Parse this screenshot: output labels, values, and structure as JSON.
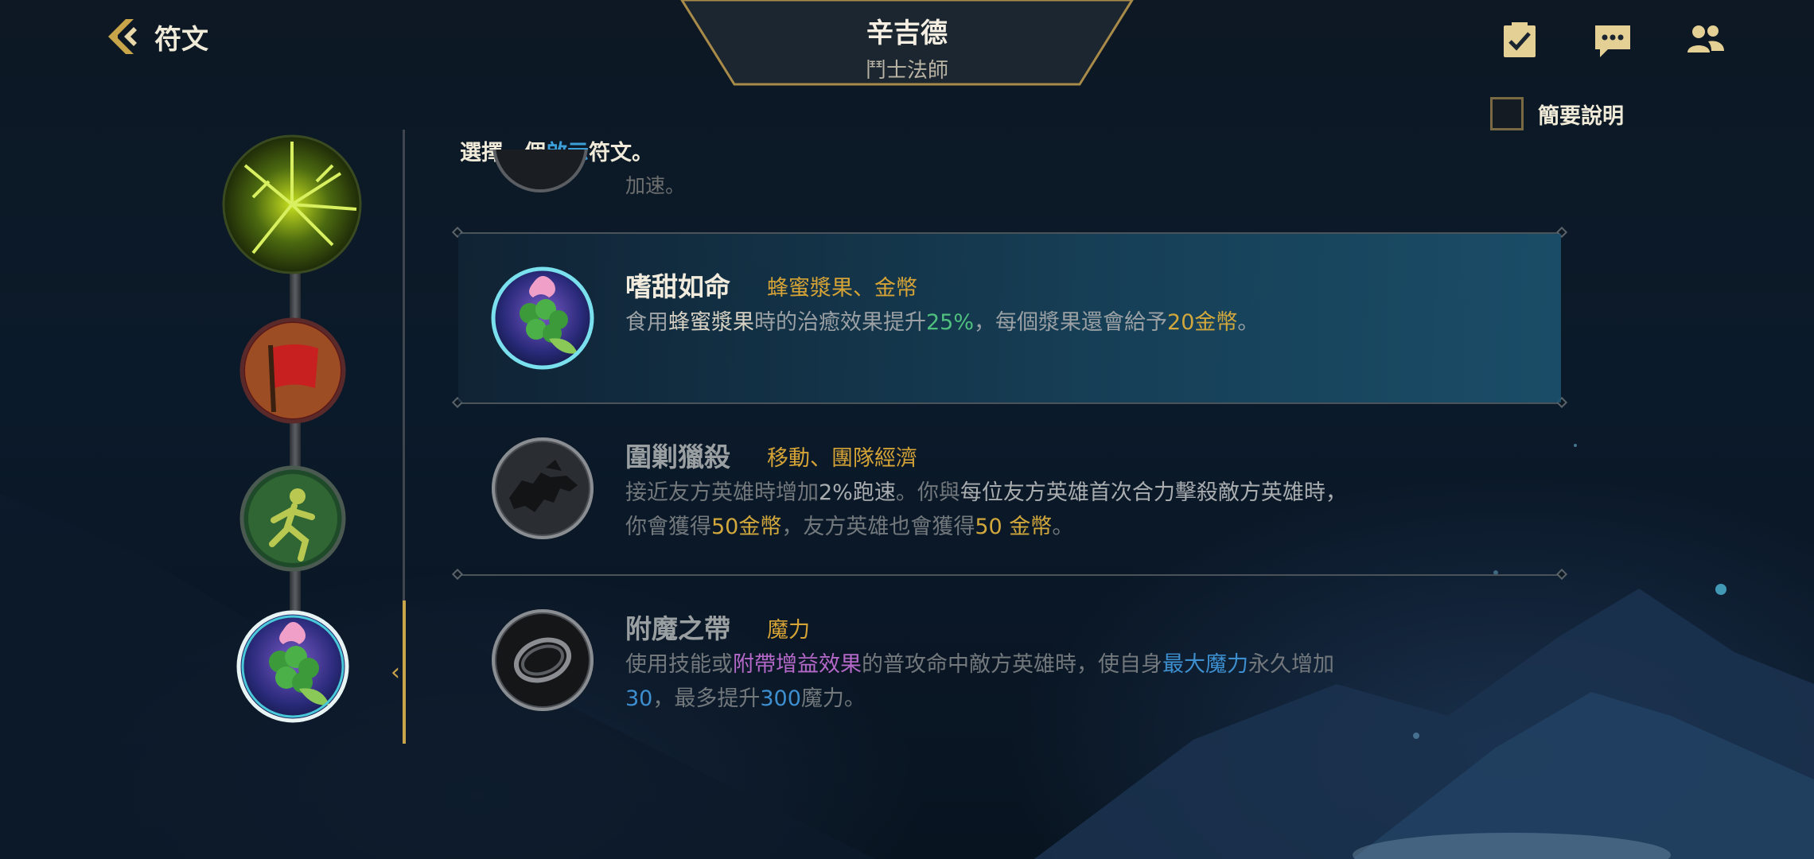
{
  "header": {
    "back_label": "符文",
    "champion_name": "辛吉德",
    "champion_role": "鬥士法師"
  },
  "toolbar": {
    "icons": [
      "checklist-icon",
      "chat-icon",
      "friends-icon"
    ]
  },
  "brief_toggle": {
    "label": "簡要說明",
    "checked": false
  },
  "instruction": {
    "prefix": "選擇一個",
    "highlight": "啟示",
    "suffix": "符文。"
  },
  "partial_item_text": "加速。",
  "rune_path": [
    "domination-keystone",
    "banner-rune",
    "runner-rune",
    "sweet-tooth-rune"
  ],
  "runes": [
    {
      "title": "嗜甜如命",
      "tags": "蜂蜜漿果、金幣",
      "desc": {
        "a": "食用",
        "b": "蜂蜜漿果",
        "c": "時的治癒效果提升",
        "d": "25%",
        "e": "，每個漿果還會給予",
        "f": "20金幣",
        "g": "。"
      },
      "selected": true
    },
    {
      "title": "圍剿獵殺",
      "tags": "移動、團隊經濟",
      "desc": {
        "a": "接近友方英雄時增加",
        "b": "2%跑速",
        "c": "。你與",
        "d": "每位友方英雄首次合力擊殺敵方英雄時，",
        "e": "你會獲得",
        "f": "50金幣",
        "g": "，友方英雄也會獲得",
        "h": "50 金幣",
        "i": "。"
      },
      "selected": false
    },
    {
      "title": "附魔之帶",
      "tags": "魔力",
      "desc": {
        "a": "使用技能或",
        "b": "附帶增益效果",
        "c": "的普攻命中敵方英雄時，使自身",
        "d": "最大魔力",
        "e": "永久增加",
        "f": "30",
        "g": "，最多提升",
        "h": "300",
        "i": "魔力。"
      },
      "selected": false
    }
  ]
}
